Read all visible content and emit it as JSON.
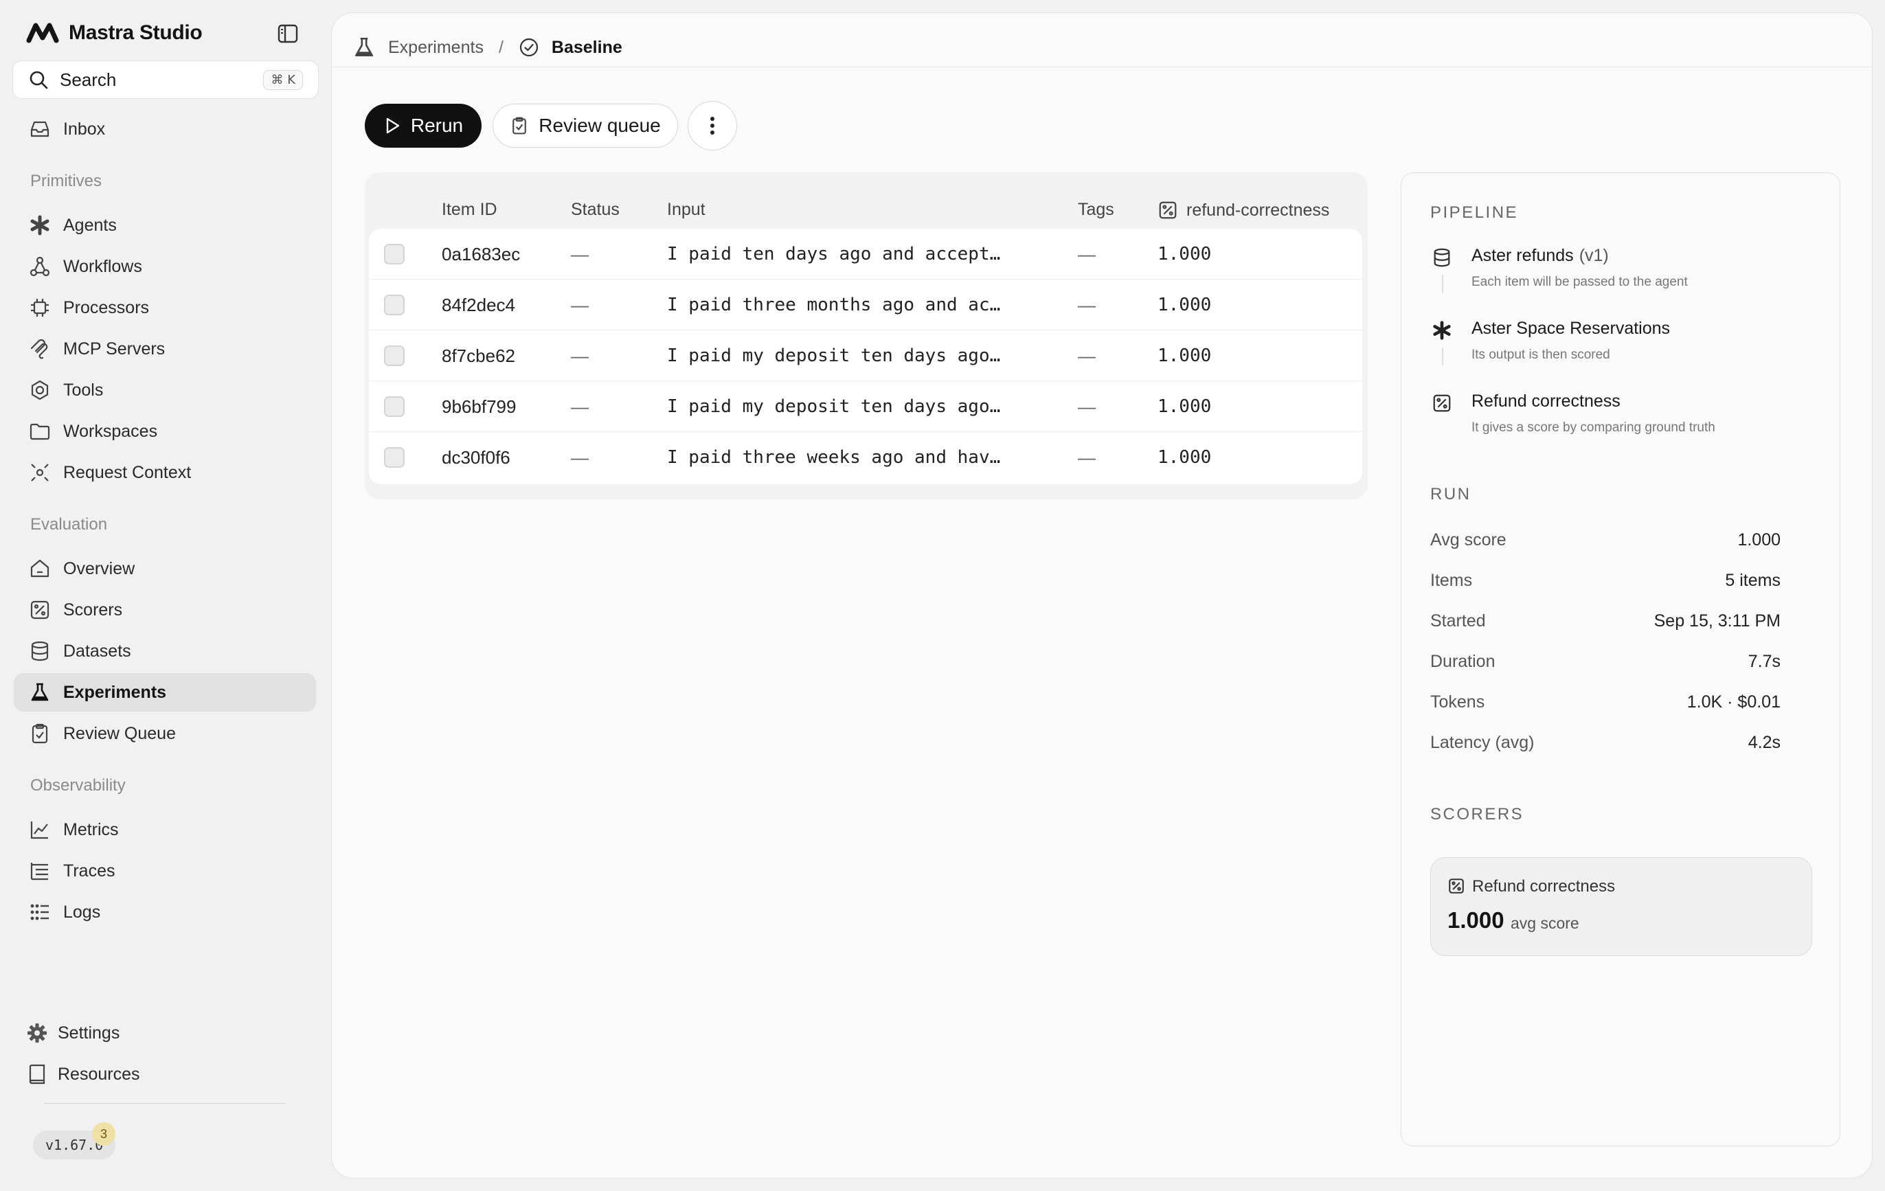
{
  "app": {
    "name": "Mastra Studio"
  },
  "search": {
    "label": "Search",
    "shortcut": "⌘ K"
  },
  "sidebar": {
    "inbox": "Inbox",
    "primitives_label": "Primitives",
    "primitives": [
      "Agents",
      "Workflows",
      "Processors",
      "MCP Servers",
      "Tools",
      "Workspaces",
      "Request Context"
    ],
    "evaluation_label": "Evaluation",
    "evaluation": [
      "Overview",
      "Scorers",
      "Datasets",
      "Experiments",
      "Review Queue"
    ],
    "observability_label": "Observability",
    "observability": [
      "Metrics",
      "Traces",
      "Logs"
    ],
    "settings": "Settings",
    "resources": "Resources",
    "version": "v1.67.0",
    "version_badge": "3",
    "active_item": "Experiments"
  },
  "breadcrumb": {
    "parent": "Experiments",
    "separator": "/",
    "current": "Baseline"
  },
  "toolbar": {
    "rerun": "Rerun",
    "review_queue": "Review queue"
  },
  "table": {
    "columns": [
      "Item ID",
      "Status",
      "Input",
      "Tags",
      "refund-correctness"
    ],
    "rows": [
      {
        "id": "0a1683ec",
        "status": "—",
        "input": "I paid ten days ago and accept…",
        "tags": "—",
        "score": "1.000"
      },
      {
        "id": "84f2dec4",
        "status": "—",
        "input": "I paid three months ago and ac…",
        "tags": "—",
        "score": "1.000"
      },
      {
        "id": "8f7cbe62",
        "status": "—",
        "input": "I paid my deposit ten days ago…",
        "tags": "—",
        "score": "1.000"
      },
      {
        "id": "9b6bf799",
        "status": "—",
        "input": "I paid my deposit ten days ago…",
        "tags": "—",
        "score": "1.000"
      },
      {
        "id": "dc30f0f6",
        "status": "—",
        "input": "I paid three weeks ago and hav…",
        "tags": "—",
        "score": "1.000"
      }
    ]
  },
  "pipeline": {
    "heading": "PIPELINE",
    "steps": [
      {
        "title": "Aster refunds",
        "version": "(v1)",
        "subtitle": "Each item will be passed to the agent",
        "icon": "database-icon"
      },
      {
        "title": "Aster Space Reservations",
        "version": "",
        "subtitle": "Its output is then scored",
        "icon": "agent-icon"
      },
      {
        "title": "Refund correctness",
        "version": "",
        "subtitle": "It gives a score by comparing ground truth",
        "icon": "scorer-icon"
      }
    ]
  },
  "run": {
    "heading": "RUN",
    "stats": [
      {
        "key": "Avg score",
        "value": "1.000"
      },
      {
        "key": "Items",
        "value": "5 items"
      },
      {
        "key": "Started",
        "value": "Sep 15, 3:11 PM"
      },
      {
        "key": "Duration",
        "value": "7.7s"
      },
      {
        "key": "Tokens",
        "value": "1.0K · $0.01"
      },
      {
        "key": "Latency (avg)",
        "value": "4.2s"
      }
    ]
  },
  "scorers": {
    "heading": "SCORERS",
    "items": [
      {
        "name": "Refund correctness",
        "score": "1.000",
        "unit": "avg score"
      }
    ]
  },
  "colors": {
    "accent": "#111111",
    "background": "#f1f1f1",
    "panel": "#fafafa",
    "badge": "#efe1a6"
  }
}
